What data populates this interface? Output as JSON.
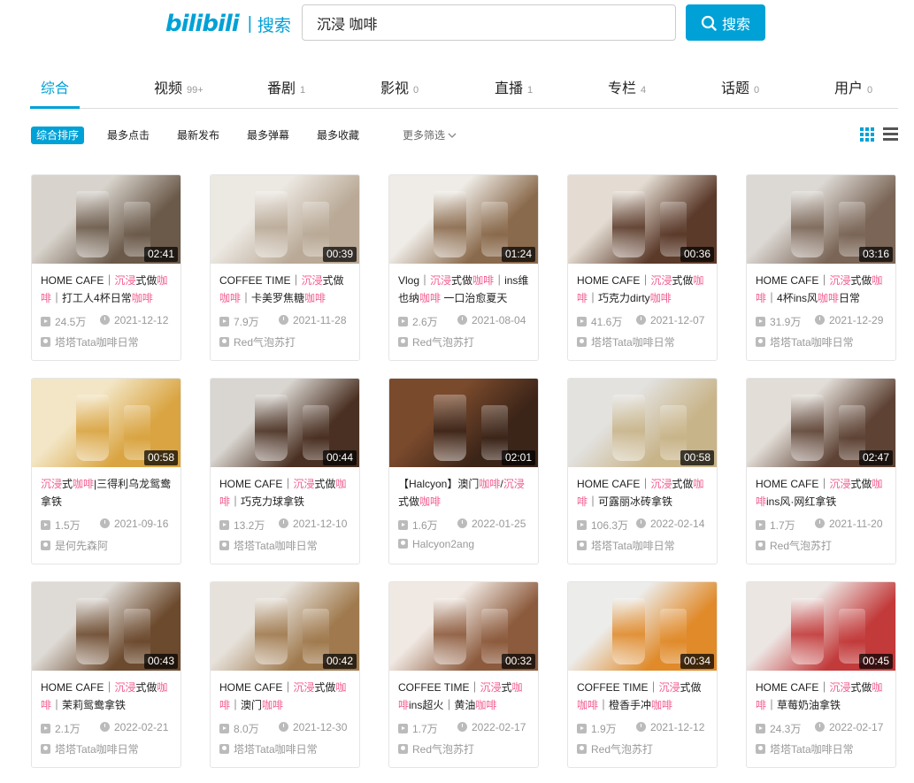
{
  "logo": {
    "word": "bilibili",
    "sub": "搜索"
  },
  "search": {
    "query": "沉浸 咖啡",
    "button_label": "搜索"
  },
  "tabs": [
    {
      "label": "综合",
      "count": ""
    },
    {
      "label": "视频",
      "count": "99+"
    },
    {
      "label": "番剧",
      "count": "1"
    },
    {
      "label": "影视",
      "count": "0"
    },
    {
      "label": "直播",
      "count": "1"
    },
    {
      "label": "专栏",
      "count": "4"
    },
    {
      "label": "话题",
      "count": "0"
    },
    {
      "label": "用户",
      "count": "0"
    }
  ],
  "filters": [
    "综合排序",
    "最多点击",
    "最新发布",
    "最多弹幕",
    "最多收藏",
    "更多筛选"
  ],
  "colors": {
    "accent": "#00a1d6",
    "highlight": "#f25d8e",
    "muted": "#999999"
  },
  "cards": [
    {
      "duration": "02:41",
      "title_parts": [
        [
          "HOME CAFE｜",
          0
        ],
        [
          "沉浸",
          1
        ],
        [
          "式做",
          0
        ],
        [
          "咖啡",
          1
        ],
        [
          "｜打工人4杯日常",
          0
        ],
        [
          "咖啡",
          1
        ]
      ],
      "views": "24.5万",
      "date": "2021-12-12",
      "uploader": "塔塔Tata咖啡日常",
      "bg": "#6b5a4a",
      "bg2": "#d8d3cc"
    },
    {
      "duration": "00:39",
      "title_parts": [
        [
          "COFFEE TIME｜",
          0
        ],
        [
          "沉浸",
          1
        ],
        [
          "式做",
          0
        ],
        [
          "咖啡",
          1
        ],
        [
          "｜卡美罗焦糖",
          0
        ],
        [
          "咖啡",
          1
        ]
      ],
      "views": "7.9万",
      "date": "2021-11-28",
      "uploader": "Red气泡苏打",
      "bg": "#b9a996",
      "bg2": "#ece8e2"
    },
    {
      "duration": "01:24",
      "title_parts": [
        [
          "Vlog｜",
          0
        ],
        [
          "沉浸",
          1
        ],
        [
          "式做",
          0
        ],
        [
          "咖啡",
          1
        ],
        [
          "｜ins维也纳",
          0
        ],
        [
          "咖啡",
          1
        ],
        [
          " 一口治愈夏天",
          0
        ]
      ],
      "views": "2.6万",
      "date": "2021-08-04",
      "uploader": "Red气泡苏打",
      "bg": "#8a6a4c",
      "bg2": "#efece7"
    },
    {
      "duration": "00:36",
      "title_parts": [
        [
          "HOME CAFE｜",
          0
        ],
        [
          "沉浸",
          1
        ],
        [
          "式做",
          0
        ],
        [
          "咖啡",
          1
        ],
        [
          "｜巧克力dirty",
          0
        ],
        [
          "咖啡",
          1
        ]
      ],
      "views": "41.6万",
      "date": "2021-12-07",
      "uploader": "塔塔Tata咖啡日常",
      "bg": "#5b3a2a",
      "bg2": "#e4dcd2"
    },
    {
      "duration": "03:16",
      "title_parts": [
        [
          "HOME CAFE｜",
          0
        ],
        [
          "沉浸",
          1
        ],
        [
          "式做",
          0
        ],
        [
          "咖啡",
          1
        ],
        [
          "｜4杯ins风",
          0
        ],
        [
          "咖啡",
          1
        ],
        [
          "日常",
          0
        ]
      ],
      "views": "31.9万",
      "date": "2021-12-29",
      "uploader": "塔塔Tata咖啡日常",
      "bg": "#7a6556",
      "bg2": "#dcd8d3"
    },
    {
      "duration": "00:58",
      "title_parts": [
        [
          "沉浸",
          1
        ],
        [
          "式",
          0
        ],
        [
          "咖啡",
          1
        ],
        [
          "|三得利乌龙鸳鸯拿铁",
          0
        ]
      ],
      "views": "1.5万",
      "date": "2021-09-16",
      "uploader": "是何先森阿",
      "bg": "#d9a441",
      "bg2": "#f3e6c6"
    },
    {
      "duration": "00:44",
      "title_parts": [
        [
          "HOME CAFE｜",
          0
        ],
        [
          "沉浸",
          1
        ],
        [
          "式做",
          0
        ],
        [
          "咖啡",
          1
        ],
        [
          "｜巧克力球拿铁",
          0
        ]
      ],
      "views": "13.2万",
      "date": "2021-12-10",
      "uploader": "塔塔Tata咖啡日常",
      "bg": "#4a3022",
      "bg2": "#d9d5d0"
    },
    {
      "duration": "02:01",
      "title_parts": [
        [
          "【Halcyon】澳门",
          0
        ],
        [
          "咖啡",
          1
        ],
        [
          "/",
          0
        ],
        [
          "沉浸",
          1
        ],
        [
          "式做",
          0
        ],
        [
          "咖啡",
          1
        ]
      ],
      "views": "1.6万",
      "date": "2022-01-25",
      "uploader": "Halcyon2ang",
      "bg": "#3b2418",
      "bg2": "#7a4a2c"
    },
    {
      "duration": "00:58",
      "title_parts": [
        [
          "HOME CAFE｜",
          0
        ],
        [
          "沉浸",
          1
        ],
        [
          "式做",
          0
        ],
        [
          "咖啡",
          1
        ],
        [
          "｜可露丽冰砖拿铁",
          0
        ]
      ],
      "views": "106.3万",
      "date": "2022-02-14",
      "uploader": "塔塔Tata咖啡日常",
      "bg": "#c8b489",
      "bg2": "#e3e2df"
    },
    {
      "duration": "02:47",
      "title_parts": [
        [
          "HOME CAFE｜",
          0
        ],
        [
          "沉浸",
          1
        ],
        [
          "式做",
          0
        ],
        [
          "咖啡",
          1
        ],
        [
          "ins风·网红拿铁",
          0
        ]
      ],
      "views": "1.7万",
      "date": "2021-11-20",
      "uploader": "Red气泡苏打",
      "bg": "#5e4335",
      "bg2": "#e2ddd7"
    },
    {
      "duration": "00:43",
      "title_parts": [
        [
          "HOME CAFE｜",
          0
        ],
        [
          "沉浸",
          1
        ],
        [
          "式做",
          0
        ],
        [
          "咖啡",
          1
        ],
        [
          "｜茉莉鸳鸯拿铁",
          0
        ]
      ],
      "views": "2.1万",
      "date": "2022-02-21",
      "uploader": "塔塔Tata咖啡日常",
      "bg": "#6c4a2e",
      "bg2": "#dedad5"
    },
    {
      "duration": "00:42",
      "title_parts": [
        [
          "HOME CAFE｜",
          0
        ],
        [
          "沉浸",
          1
        ],
        [
          "式做",
          0
        ],
        [
          "咖啡",
          1
        ],
        [
          "｜澳门",
          0
        ],
        [
          "咖啡",
          1
        ]
      ],
      "views": "8.0万",
      "date": "2021-12-30",
      "uploader": "塔塔Tata咖啡日常",
      "bg": "#a07a4e",
      "bg2": "#e6e1da"
    },
    {
      "duration": "00:32",
      "title_parts": [
        [
          "COFFEE TIME｜",
          0
        ],
        [
          "沉浸",
          1
        ],
        [
          "式",
          0
        ],
        [
          "咖啡",
          1
        ],
        [
          "ins超火｜黄油",
          0
        ],
        [
          "咖啡",
          1
        ]
      ],
      "views": "1.7万",
      "date": "2022-02-17",
      "uploader": "Red气泡苏打",
      "bg": "#8c5a3c",
      "bg2": "#f0e8e2"
    },
    {
      "duration": "00:34",
      "title_parts": [
        [
          "COFFEE TIME｜",
          0
        ],
        [
          "沉浸",
          1
        ],
        [
          "式做",
          0
        ],
        [
          "咖啡",
          1
        ],
        [
          "｜橙香手冲",
          0
        ],
        [
          "咖啡",
          1
        ]
      ],
      "views": "1.9万",
      "date": "2021-12-12",
      "uploader": "Red气泡苏打",
      "bg": "#e08a2a",
      "bg2": "#ececea"
    },
    {
      "duration": "00:45",
      "title_parts": [
        [
          "HOME CAFE｜",
          0
        ],
        [
          "沉浸",
          1
        ],
        [
          "式做",
          0
        ],
        [
          "咖啡",
          1
        ],
        [
          "｜草莓奶油拿铁",
          0
        ]
      ],
      "views": "24.3万",
      "date": "2022-02-17",
      "uploader": "塔塔Tata咖啡日常",
      "bg": "#c23a3a",
      "bg2": "#ece6e3"
    }
  ]
}
